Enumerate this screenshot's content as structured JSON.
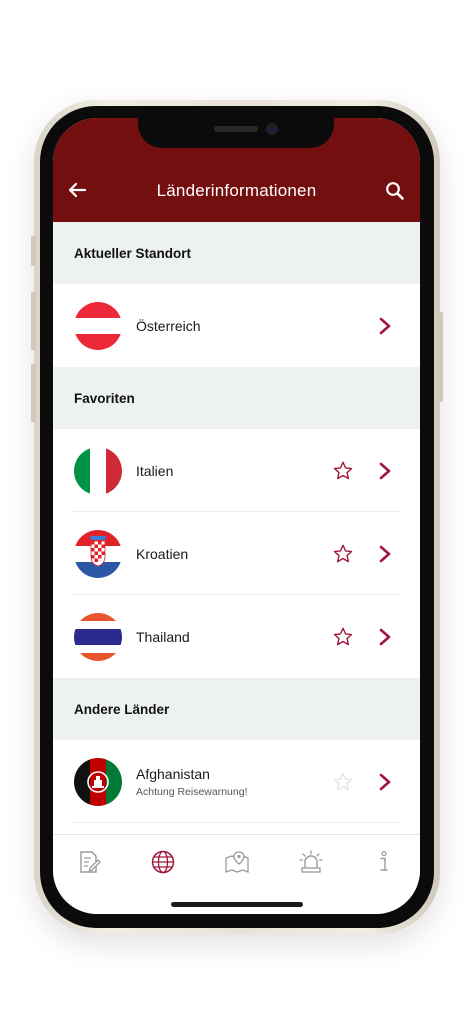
{
  "header": {
    "title": "Länderinformationen",
    "background_color": "#740f0f",
    "back_icon": "arrow-left-icon",
    "search_icon": "search-icon"
  },
  "sections": {
    "current_location": {
      "title": "Aktueller Standort",
      "items": [
        {
          "label": "Österreich",
          "flag": "austria-flag-icon"
        }
      ]
    },
    "favorites": {
      "title": "Favoriten",
      "items": [
        {
          "label": "Italien",
          "flag": "italy-flag-icon",
          "favorite": true
        },
        {
          "label": "Kroatien",
          "flag": "croatia-flag-icon",
          "favorite": true
        },
        {
          "label": "Thailand",
          "flag": "thailand-flag-icon",
          "favorite": true
        }
      ]
    },
    "other_countries": {
      "title": "Andere Länder",
      "items": [
        {
          "label": "Afghanistan",
          "subtitle": "Achtung Reisewarnung!",
          "flag": "afghanistan-flag-icon",
          "favorite": false
        }
      ]
    }
  },
  "tabbar": {
    "items": [
      {
        "icon": "document-edit-icon",
        "active": false
      },
      {
        "icon": "globe-icon",
        "active": true
      },
      {
        "icon": "map-pin-icon",
        "active": false
      },
      {
        "icon": "alarm-light-icon",
        "active": false
      },
      {
        "icon": "info-icon",
        "active": false
      }
    ]
  },
  "colors": {
    "accent": "#a0163a",
    "tab_inactive": "#9a9a9a",
    "section_background": "#eef1f2"
  }
}
